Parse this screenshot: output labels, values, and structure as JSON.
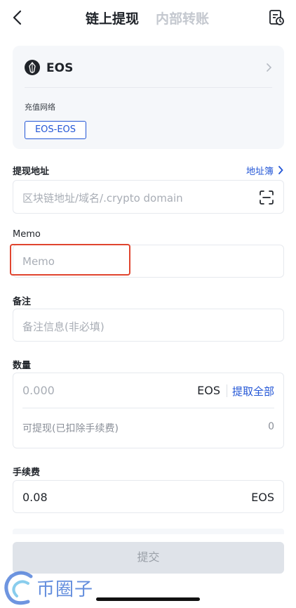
{
  "header": {
    "tab_active": "链上提现",
    "tab_inactive": "内部转账",
    "back_icon": "chevron-left-icon",
    "history_icon": "history-record-icon"
  },
  "coin": {
    "name": "EOS",
    "network_label": "充值网络",
    "network_selected": "EOS-EOS"
  },
  "address": {
    "label": "提现地址",
    "book_label": "地址簿",
    "placeholder": "区块链地址/域名/.crypto domain"
  },
  "memo": {
    "label": "Memo",
    "placeholder": "Memo"
  },
  "remark": {
    "label": "备注",
    "placeholder": "备注信息(非必填)"
  },
  "quantity": {
    "label": "数量",
    "placeholder": "0.000",
    "unit": "EOS",
    "withdraw_all": "提取全部",
    "available_label": "可提现(已扣除手续费)",
    "available_value": "0"
  },
  "fee": {
    "label": "手续费",
    "value": "0.08",
    "unit": "EOS"
  },
  "submit_label": "提交",
  "watermark": "币圈子",
  "colors": {
    "accent": "#2356d6",
    "highlight": "#e0452f",
    "card_bg": "#f5f7fa"
  }
}
